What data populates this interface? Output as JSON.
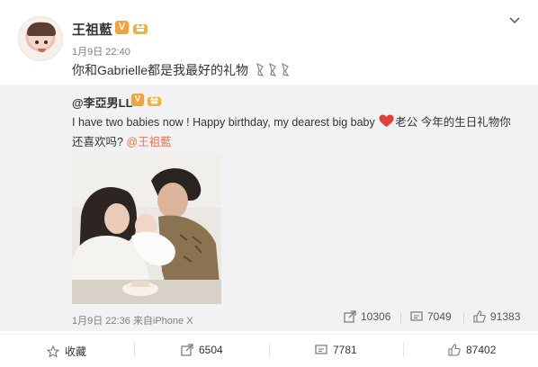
{
  "post": {
    "author": "王祖藍",
    "badge": "V",
    "timestamp": "1月9日 22:40",
    "text": "你和Gabrielle都是我最好的礼物"
  },
  "repost": {
    "author": "@李亞男LL",
    "badge": "V",
    "text_line": "I have two babies now ! Happy birthday, my dearest big baby",
    "text_after_heart": "老公 今年的生日礼物你还喜欢吗? ",
    "mention": "@王祖藍",
    "timestamp": "1月9日 22:36",
    "source": "来自iPhone X",
    "shares": "10306",
    "comments": "7049",
    "likes": "91383"
  },
  "actions": {
    "favorite_label": "收藏",
    "share_count": "6504",
    "comment_count": "7781",
    "like_count": "87402"
  },
  "colors": {
    "verified_badge": "#f2a33a",
    "mention": "#eb7350",
    "heart": "#e0403a",
    "repost_bg": "#f2f2f5",
    "meta_text": "#808080"
  },
  "icons": [
    "avatar",
    "verified-icon",
    "crown-badge-icon",
    "chevron-down-icon",
    "heart-emoji-icon",
    "star-icon",
    "share-icon",
    "comment-icon",
    "thumbs-up-icon"
  ]
}
